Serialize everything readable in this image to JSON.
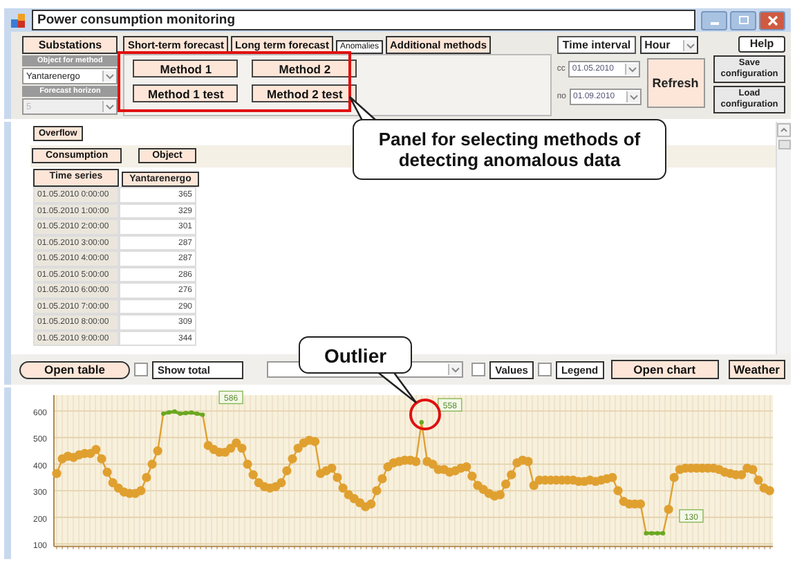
{
  "window": {
    "title": "Power consumption monitoring"
  },
  "left_panel": {
    "tab": "Substations",
    "object_label": "Object for method",
    "object_value": "Yantarenergo",
    "horizon_label": "Forecast horizon",
    "horizon_value": "5",
    "horizon_disabled": true
  },
  "tabs": [
    {
      "label": "Short-term forecast",
      "selected": false
    },
    {
      "label": "Long term forecast",
      "selected": false
    },
    {
      "label": "Anomalies",
      "selected": true
    },
    {
      "label": "Additional methods",
      "selected": false
    }
  ],
  "method_buttons": [
    "Method 1",
    "Method 2",
    "Method 1 test",
    "Method 2 test"
  ],
  "time": {
    "label": "Time interval",
    "unit": "Hour",
    "from_prefix": "cc",
    "from": "01.05.2010",
    "to_prefix": "по",
    "to": "01.09.2010",
    "refresh": "Refresh"
  },
  "side_buttons": [
    "Help",
    "Save configuration",
    "Load configuration"
  ],
  "overflow": "Overflow",
  "view_buttons": [
    "Consumption",
    "Object"
  ],
  "table": {
    "columns": [
      "Time series",
      "Yantarenergo"
    ],
    "rows": [
      [
        "01.05.2010 0:00:00",
        "365"
      ],
      [
        "01.05.2010 1:00:00",
        "329"
      ],
      [
        "01.05.2010 2:00:00",
        "301"
      ],
      [
        "01.05.2010 3:00:00",
        "287"
      ],
      [
        "01.05.2010 4:00:00",
        "287"
      ],
      [
        "01.05.2010 5:00:00",
        "286"
      ],
      [
        "01.05.2010 6:00:00",
        "276"
      ],
      [
        "01.05.2010 7:00:00",
        "290"
      ],
      [
        "01.05.2010 8:00:00",
        "309"
      ],
      [
        "01.05.2010 9:00:00",
        "344"
      ]
    ]
  },
  "table_controls": {
    "open_table": "Open table",
    "show_total": {
      "label": "Show total",
      "checked": false
    }
  },
  "chart_controls": {
    "values": {
      "label": "Values",
      "checked": false
    },
    "legend": {
      "label": "Legend",
      "checked": false
    },
    "open_chart": "Open chart",
    "weather": "Weather"
  },
  "chart": {
    "chart_data": {
      "type": "line",
      "ylim": [
        90,
        660
      ],
      "yticks": [
        100,
        200,
        300,
        400,
        500,
        600
      ],
      "series": [
        {
          "color": "#e0a030",
          "marker": "circle",
          "values": [
            365,
            420,
            430,
            425,
            435,
            440,
            440,
            455,
            420,
            370,
            330,
            310,
            295,
            290,
            290,
            300,
            350,
            400,
            450,
            590,
            595,
            598,
            590,
            592,
            594,
            590,
            586,
            470,
            455,
            445,
            445,
            460,
            480,
            460,
            400,
            360,
            330,
            315,
            310,
            315,
            330,
            375,
            420,
            460,
            480,
            490,
            485,
            365,
            375,
            385,
            350,
            310,
            285,
            270,
            255,
            240,
            250,
            300,
            345,
            390,
            405,
            410,
            415,
            415,
            410,
            558,
            410,
            400,
            380,
            380,
            370,
            375,
            385,
            390,
            355,
            320,
            305,
            290,
            280,
            285,
            325,
            360,
            405,
            415,
            410,
            320,
            340,
            340,
            340,
            340,
            340,
            340,
            340,
            335,
            335,
            340,
            335,
            340,
            345,
            350,
            300,
            260,
            250,
            250,
            250,
            140,
            140,
            140,
            140,
            230,
            350,
            380,
            385,
            385,
            385,
            385,
            385,
            385,
            380,
            370,
            365,
            360,
            360,
            385,
            380,
            340,
            310,
            300
          ]
        },
        {
          "color": "#6aa820",
          "marker": "circle",
          "values": [
            null,
            null,
            null,
            null,
            null,
            null,
            null,
            null,
            null,
            null,
            null,
            null,
            null,
            null,
            null,
            null,
            null,
            null,
            null,
            590,
            595,
            598,
            590,
            592,
            594,
            590,
            586,
            null,
            null,
            null,
            null,
            null,
            null,
            null,
            null,
            null,
            null,
            null,
            null,
            null,
            null,
            null,
            null,
            null,
            null,
            null,
            null,
            null,
            null,
            null,
            null,
            null,
            null,
            null,
            null,
            null,
            null,
            null,
            null,
            null,
            null,
            null,
            null,
            null,
            null,
            558,
            null,
            null,
            null,
            null,
            null,
            null,
            null,
            null,
            null,
            null,
            null,
            null,
            null,
            null,
            null,
            null,
            null,
            null,
            null,
            null,
            null,
            null,
            null,
            null,
            null,
            null,
            null,
            null,
            null,
            null,
            null,
            null,
            null,
            null,
            null,
            null,
            null,
            null,
            null,
            140,
            140,
            140,
            140,
            null,
            null,
            null,
            null,
            null,
            null,
            null,
            null,
            null,
            null,
            null,
            null,
            null,
            null,
            null,
            null,
            null,
            null,
            null,
            null,
            null
          ]
        }
      ],
      "grid": true,
      "annotations": [
        "586",
        "558",
        "130"
      ]
    }
  },
  "callouts": [
    {
      "text": "Panel for selecting methods of detecting anomalous data"
    },
    {
      "text": "Outlier"
    }
  ]
}
